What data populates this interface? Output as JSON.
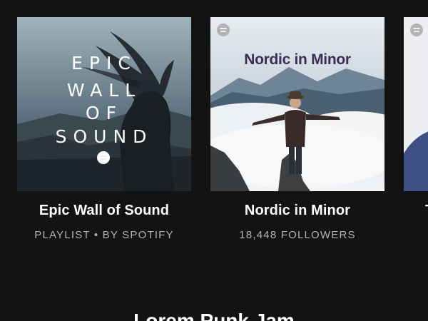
{
  "cards": [
    {
      "title": "Epic Wall of Sound",
      "subtitle": "PLAYLIST • BY SPOTIFY",
      "cover_text": [
        "EPIC",
        "WALL",
        "OF",
        "SOUND"
      ],
      "cover_icon": "spotify-logo-icon"
    },
    {
      "title": "Nordic in Minor",
      "subtitle": "18,448 FOLLOWERS",
      "cover_text": "Nordic in Minor",
      "cover_icon": "spotify-logo-icon"
    },
    {
      "title": "T",
      "cover_icon": "spotify-logo-icon"
    }
  ],
  "section_heading": "Lorem Punk Jam"
}
